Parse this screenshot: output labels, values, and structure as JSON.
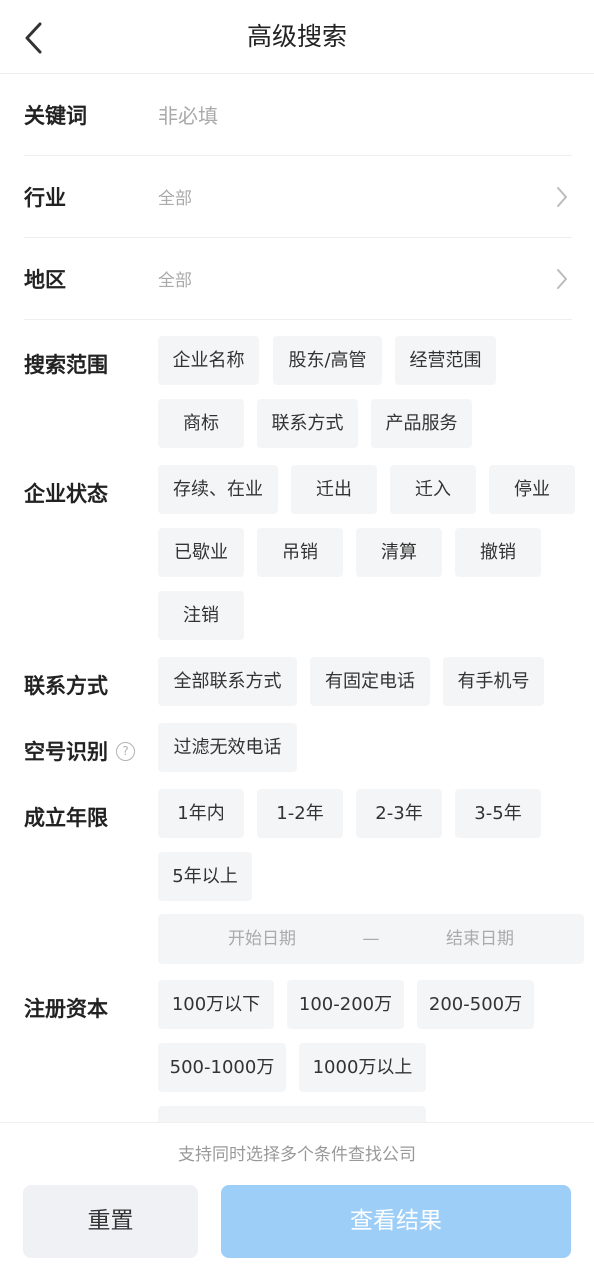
{
  "header": {
    "title": "高级搜索",
    "back_icon": "chevron-left-icon"
  },
  "form": {
    "keyword": {
      "label": "关键词",
      "placeholder": "非必填"
    },
    "industry": {
      "label": "行业",
      "value": "全部"
    },
    "region": {
      "label": "地区",
      "value": "全部"
    }
  },
  "sections": {
    "scope": {
      "label": "搜索范围",
      "options": [
        "企业名称",
        "股东/高管",
        "经营范围",
        "商标",
        "联系方式",
        "产品服务"
      ]
    },
    "status": {
      "label": "企业状态",
      "options": [
        "存续、在业",
        "迁出",
        "迁入",
        "停业",
        "已歇业",
        "吊销",
        "清算",
        "撤销",
        "注销"
      ]
    },
    "contact": {
      "label": "联系方式",
      "options": [
        "全部联系方式",
        "有固定电话",
        "有手机号"
      ]
    },
    "empty_number": {
      "label": "空号识别",
      "help_icon": "help-circle-icon",
      "help_glyph": "?",
      "options": [
        "过滤无效电话"
      ]
    },
    "years": {
      "label": "成立年限",
      "options": [
        "1年内",
        "1-2年",
        "2-3年",
        "3-5年",
        "5年以上"
      ],
      "date_range": {
        "start": "开始日期",
        "separator": "—",
        "end": "结束日期"
      }
    },
    "capital": {
      "label": "注册资本",
      "options": [
        "100万以下",
        "100-200万",
        "200-500万",
        "500-1000万",
        "1000万以上"
      ]
    }
  },
  "footer": {
    "tip": "支持同时选择多个条件查找公司",
    "reset": "重置",
    "view": "查看结果"
  }
}
